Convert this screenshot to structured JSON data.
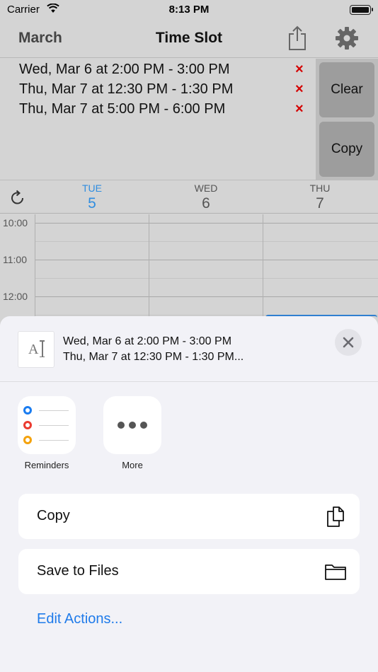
{
  "status_bar": {
    "carrier": "Carrier",
    "time": "8:13 PM"
  },
  "nav": {
    "month": "March",
    "title": "Time Slot"
  },
  "slots": [
    {
      "text": "Wed, Mar 6 at 2:00 PM - 3:00 PM",
      "remove": "×"
    },
    {
      "text": "Thu, Mar 7 at 12:30 PM - 1:30 PM",
      "remove": "×"
    },
    {
      "text": "Thu, Mar 7 at 5:00 PM - 6:00 PM",
      "remove": "×"
    }
  ],
  "side_buttons": {
    "clear": "Clear",
    "copy": "Copy"
  },
  "week": {
    "days": [
      {
        "name": "TUE",
        "num": "5",
        "today": true
      },
      {
        "name": "WED",
        "num": "6",
        "today": false
      },
      {
        "name": "THU",
        "num": "7",
        "today": false
      }
    ],
    "times": [
      "10:00",
      "11:00",
      "12:00"
    ]
  },
  "share_sheet": {
    "preview_line1": "Wed, Mar 6 at 2:00 PM - 3:00 PM",
    "preview_line2": "Thu, Mar 7 at 12:30 PM - 1:30 PM...",
    "preview_glyph": "A",
    "apps": [
      {
        "label": "Reminders",
        "icon": "reminders-icon"
      },
      {
        "label": "More",
        "icon": "more-icon"
      }
    ],
    "actions": [
      {
        "label": "Copy",
        "icon": "copy-icon"
      },
      {
        "label": "Save to Files",
        "icon": "folder-icon"
      }
    ],
    "edit_actions": "Edit Actions..."
  },
  "colors": {
    "accent": "#1f7bea",
    "today": "#2f8de0",
    "remove": "#d40000",
    "reminder_blue": "#1a7cf0",
    "reminder_red": "#eb3b30",
    "reminder_orange": "#f4a20c"
  }
}
